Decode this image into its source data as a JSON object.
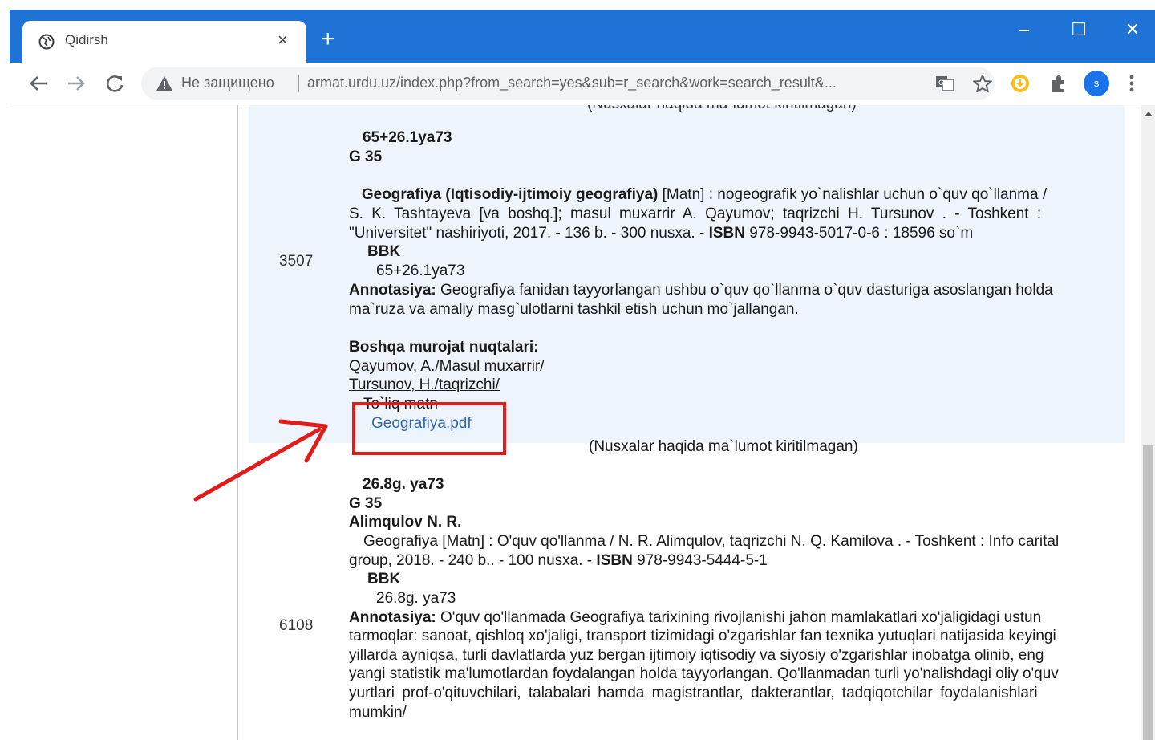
{
  "browser": {
    "tab_title": "Qidirsh",
    "tab_close": "×",
    "new_tab": "+",
    "minimize": "–",
    "maximize": "☐",
    "close": "✕",
    "security_label": "Не защищено",
    "url": "armat.urdu.uz/index.php?from_search=yes&sub=r_search&work=search_result&...",
    "profile_letter": "s",
    "accent_color": "#1f72d6"
  },
  "page": {
    "cut_top_text": "(Nusxalar haqida ma`lumot kiritilmagan)",
    "record1": {
      "number": "3507",
      "shelf_code": "65+26.1ya73",
      "author_code": "G 35",
      "title_bold": "Geografiya (Iqtisodiy-ijtimoiy geografiya)",
      "line1_rest": " [Matn] : nogeografik yo`nalishlar uchun o`quv qo`llanma /",
      "line2": "S. K. Tashtayeva [va boshq.]; masul muxarrir A. Qayumov; taqrizchi H. Tursunov . - Toshkent :",
      "line3_pre": "\"Universitet\" nashiriyoti, 2017. - 136 b. - 300 nusxa. - ",
      "isbn_label": "ISBN",
      "line3_post": " 978-9943-5017-0-6 : 18596 so`m",
      "bbk_label": "BBK",
      "bbk_value": "65+26.1ya73",
      "annot_label": "Annotasiya:",
      "annot_line1": " Geografiya fanidan tayyorlangan ushbu o`quv qo`llanma o`quv dasturiga asoslangan holda",
      "annot_line2": "ma`ruza va amaliy masg`ulotlarni tashkil etish uchun mo`jallangan.",
      "refs_label": "Boshqa murojat nuqtalari:",
      "ref1": "Qayumov, A./Masul muxarrir/",
      "ref2": "Tursunov, H./taqrizchi/",
      "fulltext_label": "To`liq matn",
      "file_link": "Geografiya.pdf",
      "copies_note": "(Nusxalar haqida ma`lumot kiritilmagan)"
    },
    "record2": {
      "number": "6108",
      "shelf_code": "26.8g. ya73",
      "author_code": "G 35",
      "author": "Alimqulov N. R.",
      "line1": "Geografiya [Matn] : O'quv qo'llanma / N. R. Alimqulov, taqrizchi N. Q. Kamilova . - Toshkent : Info carital",
      "line2_pre": "group, 2018. - 240 b.. - 100 nusxa. - ",
      "isbn_label": "ISBN",
      "line2_post": " 978-9943-5444-5-1",
      "bbk_label": "BBK",
      "bbk_value": "26.8g. ya73",
      "annot_label": "Annotasiya:",
      "annot_line1": " O'quv qo'llanmada Geografiya tarixining rivojlanishi jahon mamlakatlari xo'jaligidagi ustun",
      "annot_line2": "tarmoqlar: sanoat, qishloq xo'jaligi, transport tizimidagi o'zgarishlar fan texnika yutuqlari natijasida keyingi",
      "annot_line3": "yillarda ayniqsa, turli davlatlarda yuz bergan ijtimoiy iqtisodiy va siyosiy o'zgarishlar inobatga olinib, eng",
      "annot_line4": "yangi statistik ma'lumotlardan foydalangan holda tayyorlangan. Qo'llanmadan turli yo'nalishdagi oliy o'quv",
      "annot_line5": "yurtlari prof-o'qituvchilari, talabalari hamda magistrantlar, dakterantlar, tadqiqotchilar foydalanishlari",
      "annot_line6": "mumkin/"
    }
  },
  "annotation": {
    "highlight_color": "#e01c1c"
  }
}
